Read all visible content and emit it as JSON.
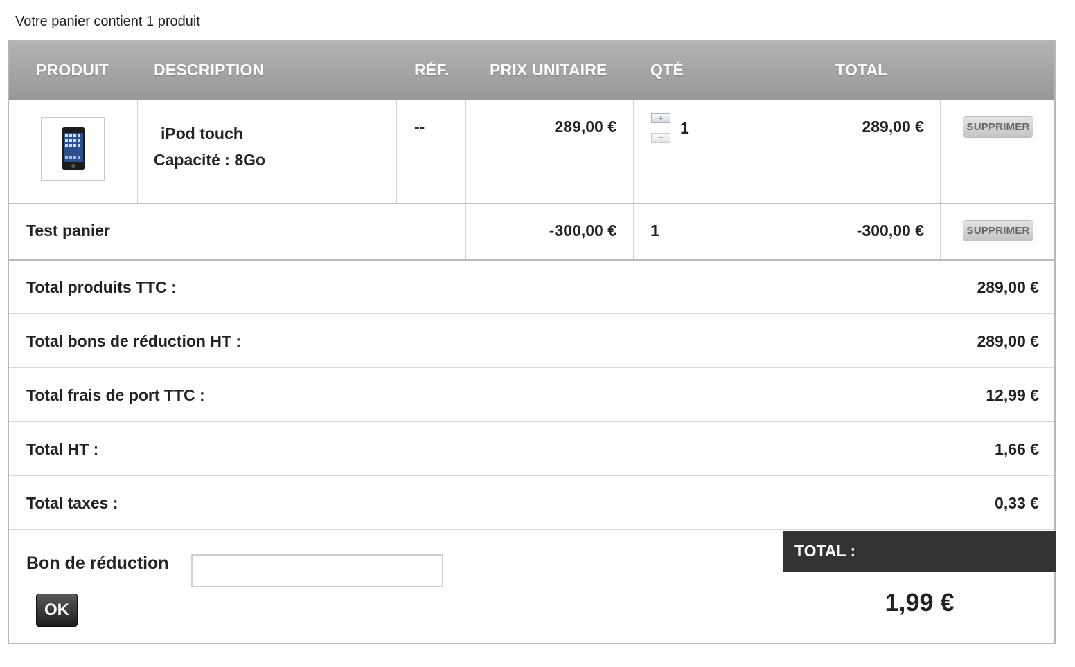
{
  "cart_summary": "Votre panier contient 1 produit",
  "columns": {
    "product": "PRODUIT",
    "description": "DESCRIPTION",
    "ref": "RÉF.",
    "unit_price": "PRIX UNITAIRE",
    "qty": "QTÉ",
    "total": "TOTAL"
  },
  "items": [
    {
      "name": "iPod touch",
      "option": "Capacité : 8Go",
      "ref": "--",
      "unit_price": "289,00 €",
      "qty": "1",
      "qty_plus": "+",
      "qty_minus": "−",
      "total": "289,00 €",
      "delete_label": "SUPPRIMER"
    }
  ],
  "discounts": [
    {
      "name": "Test panier",
      "unit_price": "-300,00 €",
      "qty": "1",
      "total": "-300,00 €",
      "delete_label": "SUPPRIMER"
    }
  ],
  "totals": [
    {
      "label": "Total produits TTC :",
      "value": "289,00 €"
    },
    {
      "label": "Total bons de réduction HT :",
      "value": "289,00 €"
    },
    {
      "label": "Total frais de port TTC :",
      "value": "12,99 €"
    },
    {
      "label": "Total HT :",
      "value": "1,66 €"
    },
    {
      "label": "Total taxes :",
      "value": "0,33 €"
    }
  ],
  "coupon": {
    "label": "Bon de réduction",
    "value": "",
    "button": "OK"
  },
  "grand_total": {
    "label": "TOTAL :",
    "value": "1,99 €"
  },
  "colors": {
    "header_bg": "#a6a6a6",
    "total_header_bg": "#333333",
    "ok_button_bg": "#2e2e2e"
  }
}
